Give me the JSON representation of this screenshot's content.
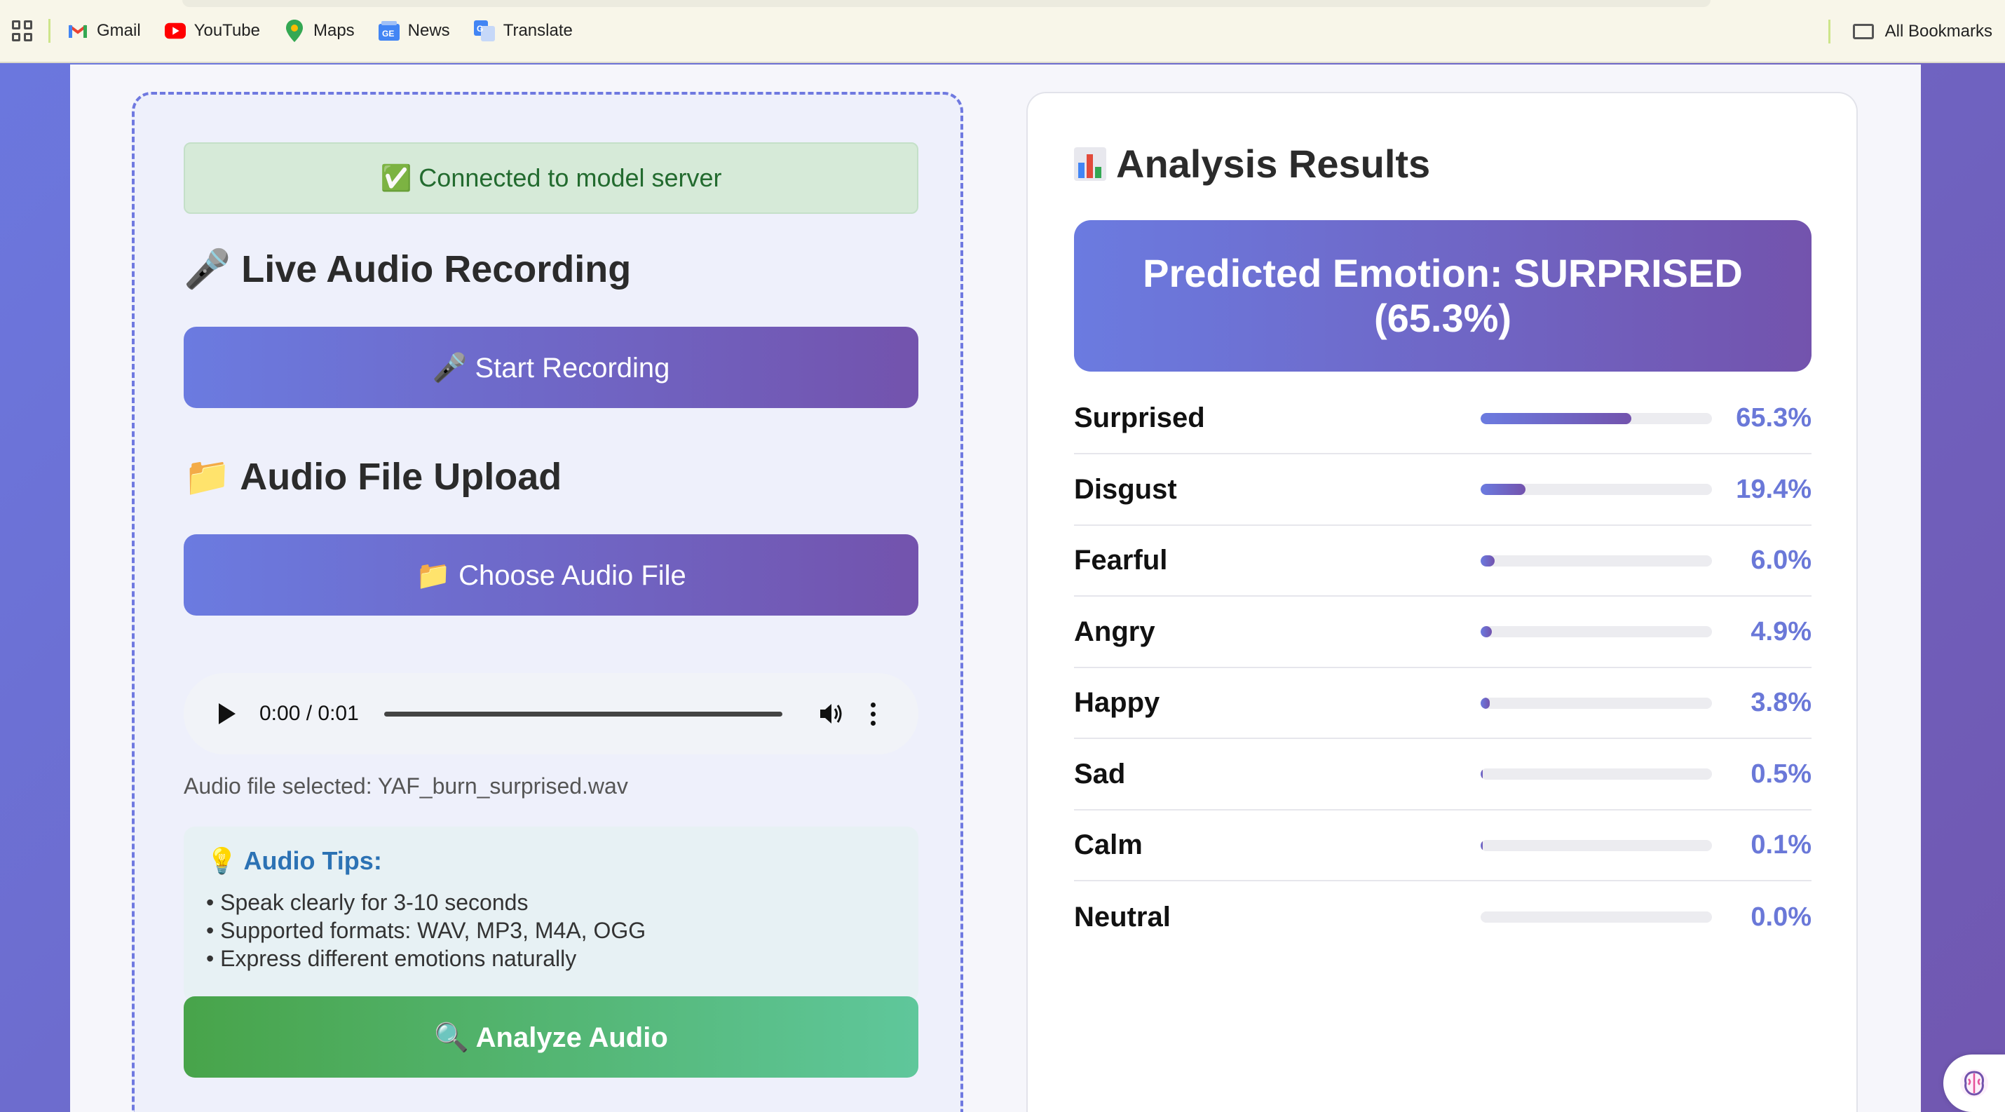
{
  "bookmarks_bar": {
    "items": [
      {
        "label": "Gmail",
        "icon": "gmail-icon"
      },
      {
        "label": "YouTube",
        "icon": "youtube-icon"
      },
      {
        "label": "Maps",
        "icon": "maps-icon"
      },
      {
        "label": "News",
        "icon": "news-icon"
      },
      {
        "label": "Translate",
        "icon": "translate-icon"
      }
    ],
    "all_bookmarks": "All Bookmarks"
  },
  "left": {
    "status": "✅ Connected to model server",
    "live_heading": "🎤 Live Audio Recording",
    "record_button": "🎤 Start Recording",
    "upload_heading": "📁 Audio File Upload",
    "choose_button": "📁 Choose Audio File",
    "player": {
      "time": "0:00 / 0:01"
    },
    "selected_file": "Audio file selected: YAF_burn_surprised.wav",
    "tips": {
      "title": "💡 Audio Tips:",
      "items": [
        "• Speak clearly for 3-10 seconds",
        "• Supported formats: WAV, MP3, M4A, OGG",
        "• Express different emotions naturally"
      ]
    },
    "analyze_button": "🔍 Analyze Audio"
  },
  "right": {
    "title_icon": "bar-chart-icon",
    "title": "Analysis Results",
    "prediction_line1": "Predicted Emotion: SURPRISED",
    "prediction_line2": "(65.3%)",
    "emotions": [
      {
        "name": "Surprised",
        "value": 65.3,
        "label": "65.3%"
      },
      {
        "name": "Disgust",
        "value": 19.4,
        "label": "19.4%"
      },
      {
        "name": "Fearful",
        "value": 6.0,
        "label": "6.0%"
      },
      {
        "name": "Angry",
        "value": 4.9,
        "label": "4.9%"
      },
      {
        "name": "Happy",
        "value": 3.8,
        "label": "3.8%"
      },
      {
        "name": "Sad",
        "value": 0.5,
        "label": "0.5%"
      },
      {
        "name": "Calm",
        "value": 0.1,
        "label": "0.1%"
      },
      {
        "name": "Neutral",
        "value": 0.0,
        "label": "0.0%"
      }
    ]
  },
  "colors": {
    "accent_start": "#6b7be0",
    "accent_end": "#7353ad",
    "success": "#236b2f",
    "analyze_start": "#48a44a",
    "analyze_end": "#5fc79b"
  }
}
